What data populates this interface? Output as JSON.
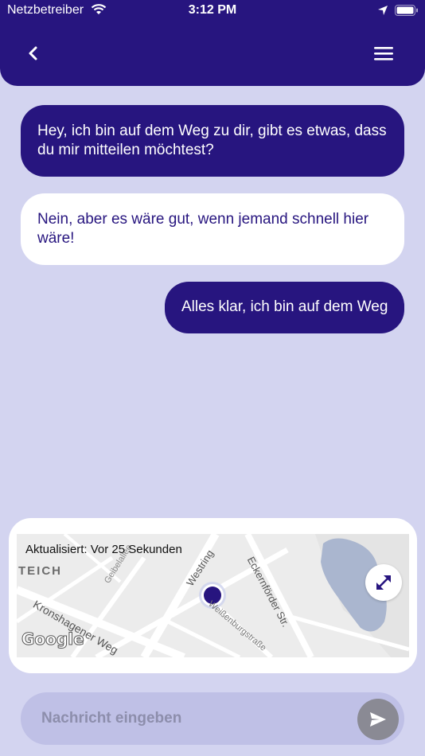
{
  "status_bar": {
    "carrier": "Netzbetreiber",
    "time": "3:12 PM"
  },
  "header": {
    "back_icon": "chevron-left-icon",
    "menu_icon": "hamburger-menu-icon"
  },
  "messages": [
    {
      "direction": "outgoing",
      "text": "Hey, ich bin auf dem Weg zu dir, gibt es etwas, dass du mir mitteilen möchtest?"
    },
    {
      "direction": "incoming",
      "text": "Nein, aber es wäre gut, wenn jemand schnell hier wäre!"
    },
    {
      "direction": "outgoing",
      "text": "Alles klar, ich bin auf dem Weg"
    }
  ],
  "map": {
    "updated_text": "Aktualisiert: Vor 25 Sekunden",
    "labels": {
      "teich": "TEICH",
      "geibelallee": "Geibelallee",
      "westring": "Westring",
      "eckernfoerder": "Eckernförder Str.",
      "kronshagener": "Kronshagener Weg",
      "weissenburg": "Weißenburgstraße",
      "google": "Google"
    },
    "expand_icon": "expand-arrows-icon"
  },
  "composer": {
    "placeholder": "Nachricht eingeben",
    "send_icon": "send-icon"
  },
  "colors": {
    "primary": "#27157f",
    "background": "#d3d4f0",
    "input": "#bfc0e6"
  }
}
